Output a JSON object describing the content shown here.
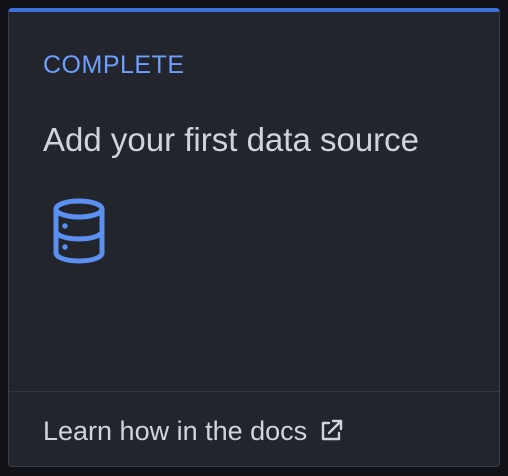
{
  "card": {
    "status": "COMPLETE",
    "title": "Add your first data source",
    "icon": "database-icon",
    "footer": {
      "link_label": "Learn how in the docs",
      "link_icon": "external-link-icon"
    }
  },
  "colors": {
    "accent": "#3d71d9",
    "status_text": "#6e9fff",
    "icon": "#5b8ff0",
    "card_background": "#22252b",
    "page_background": "#111217",
    "text": "#d0d4dc"
  }
}
